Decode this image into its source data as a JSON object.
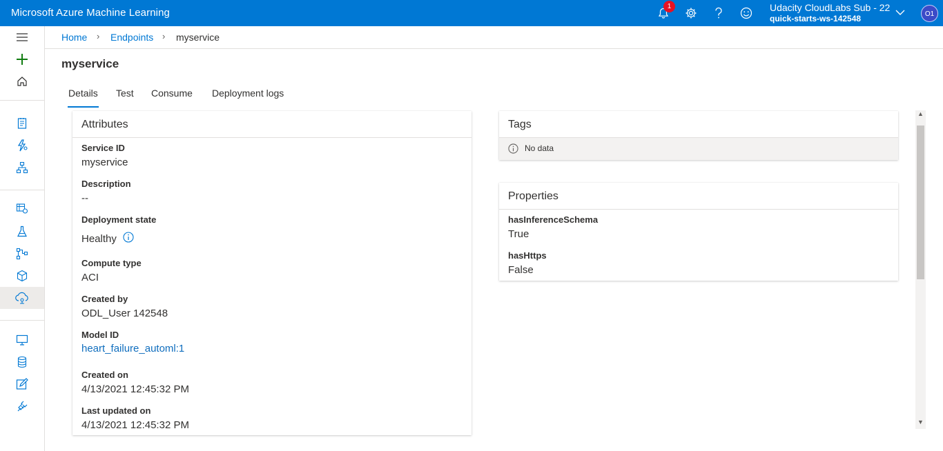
{
  "app": {
    "title": "Microsoft Azure Machine Learning"
  },
  "topbar": {
    "notification_count": "1",
    "account_sub": "Udacity CloudLabs Sub - 22",
    "account_workspace": "quick-starts-ws-142548",
    "avatar_initials": "O1"
  },
  "breadcrumb": {
    "home": "Home",
    "endpoints": "Endpoints",
    "current": "myservice"
  },
  "page": {
    "title": "myservice"
  },
  "tabs": [
    {
      "label": "Details"
    },
    {
      "label": "Test"
    },
    {
      "label": "Consume"
    },
    {
      "label": "Deployment logs"
    }
  ],
  "attributes": {
    "title": "Attributes",
    "items": [
      {
        "label": "Service ID",
        "value": "myservice"
      },
      {
        "label": "Description",
        "value": "--"
      },
      {
        "label": "Deployment state",
        "value": "Healthy"
      },
      {
        "label": "Compute type",
        "value": "ACI"
      },
      {
        "label": "Created by",
        "value": "ODL_User 142548"
      },
      {
        "label": "Model ID",
        "value": "heart_failure_automl:1"
      },
      {
        "label": "Created on",
        "value": "4/13/2021 12:45:32 PM"
      },
      {
        "label": "Last updated on",
        "value": "4/13/2021 12:45:32 PM"
      }
    ]
  },
  "tags": {
    "title": "Tags",
    "empty_text": "No data"
  },
  "properties": {
    "title": "Properties",
    "items": [
      {
        "label": "hasInferenceSchema",
        "value": "True"
      },
      {
        "label": "hasHttps",
        "value": "False"
      }
    ]
  },
  "colors": {
    "accent": "#0078d4",
    "badge": "#e81123",
    "link": "#106ebe"
  }
}
